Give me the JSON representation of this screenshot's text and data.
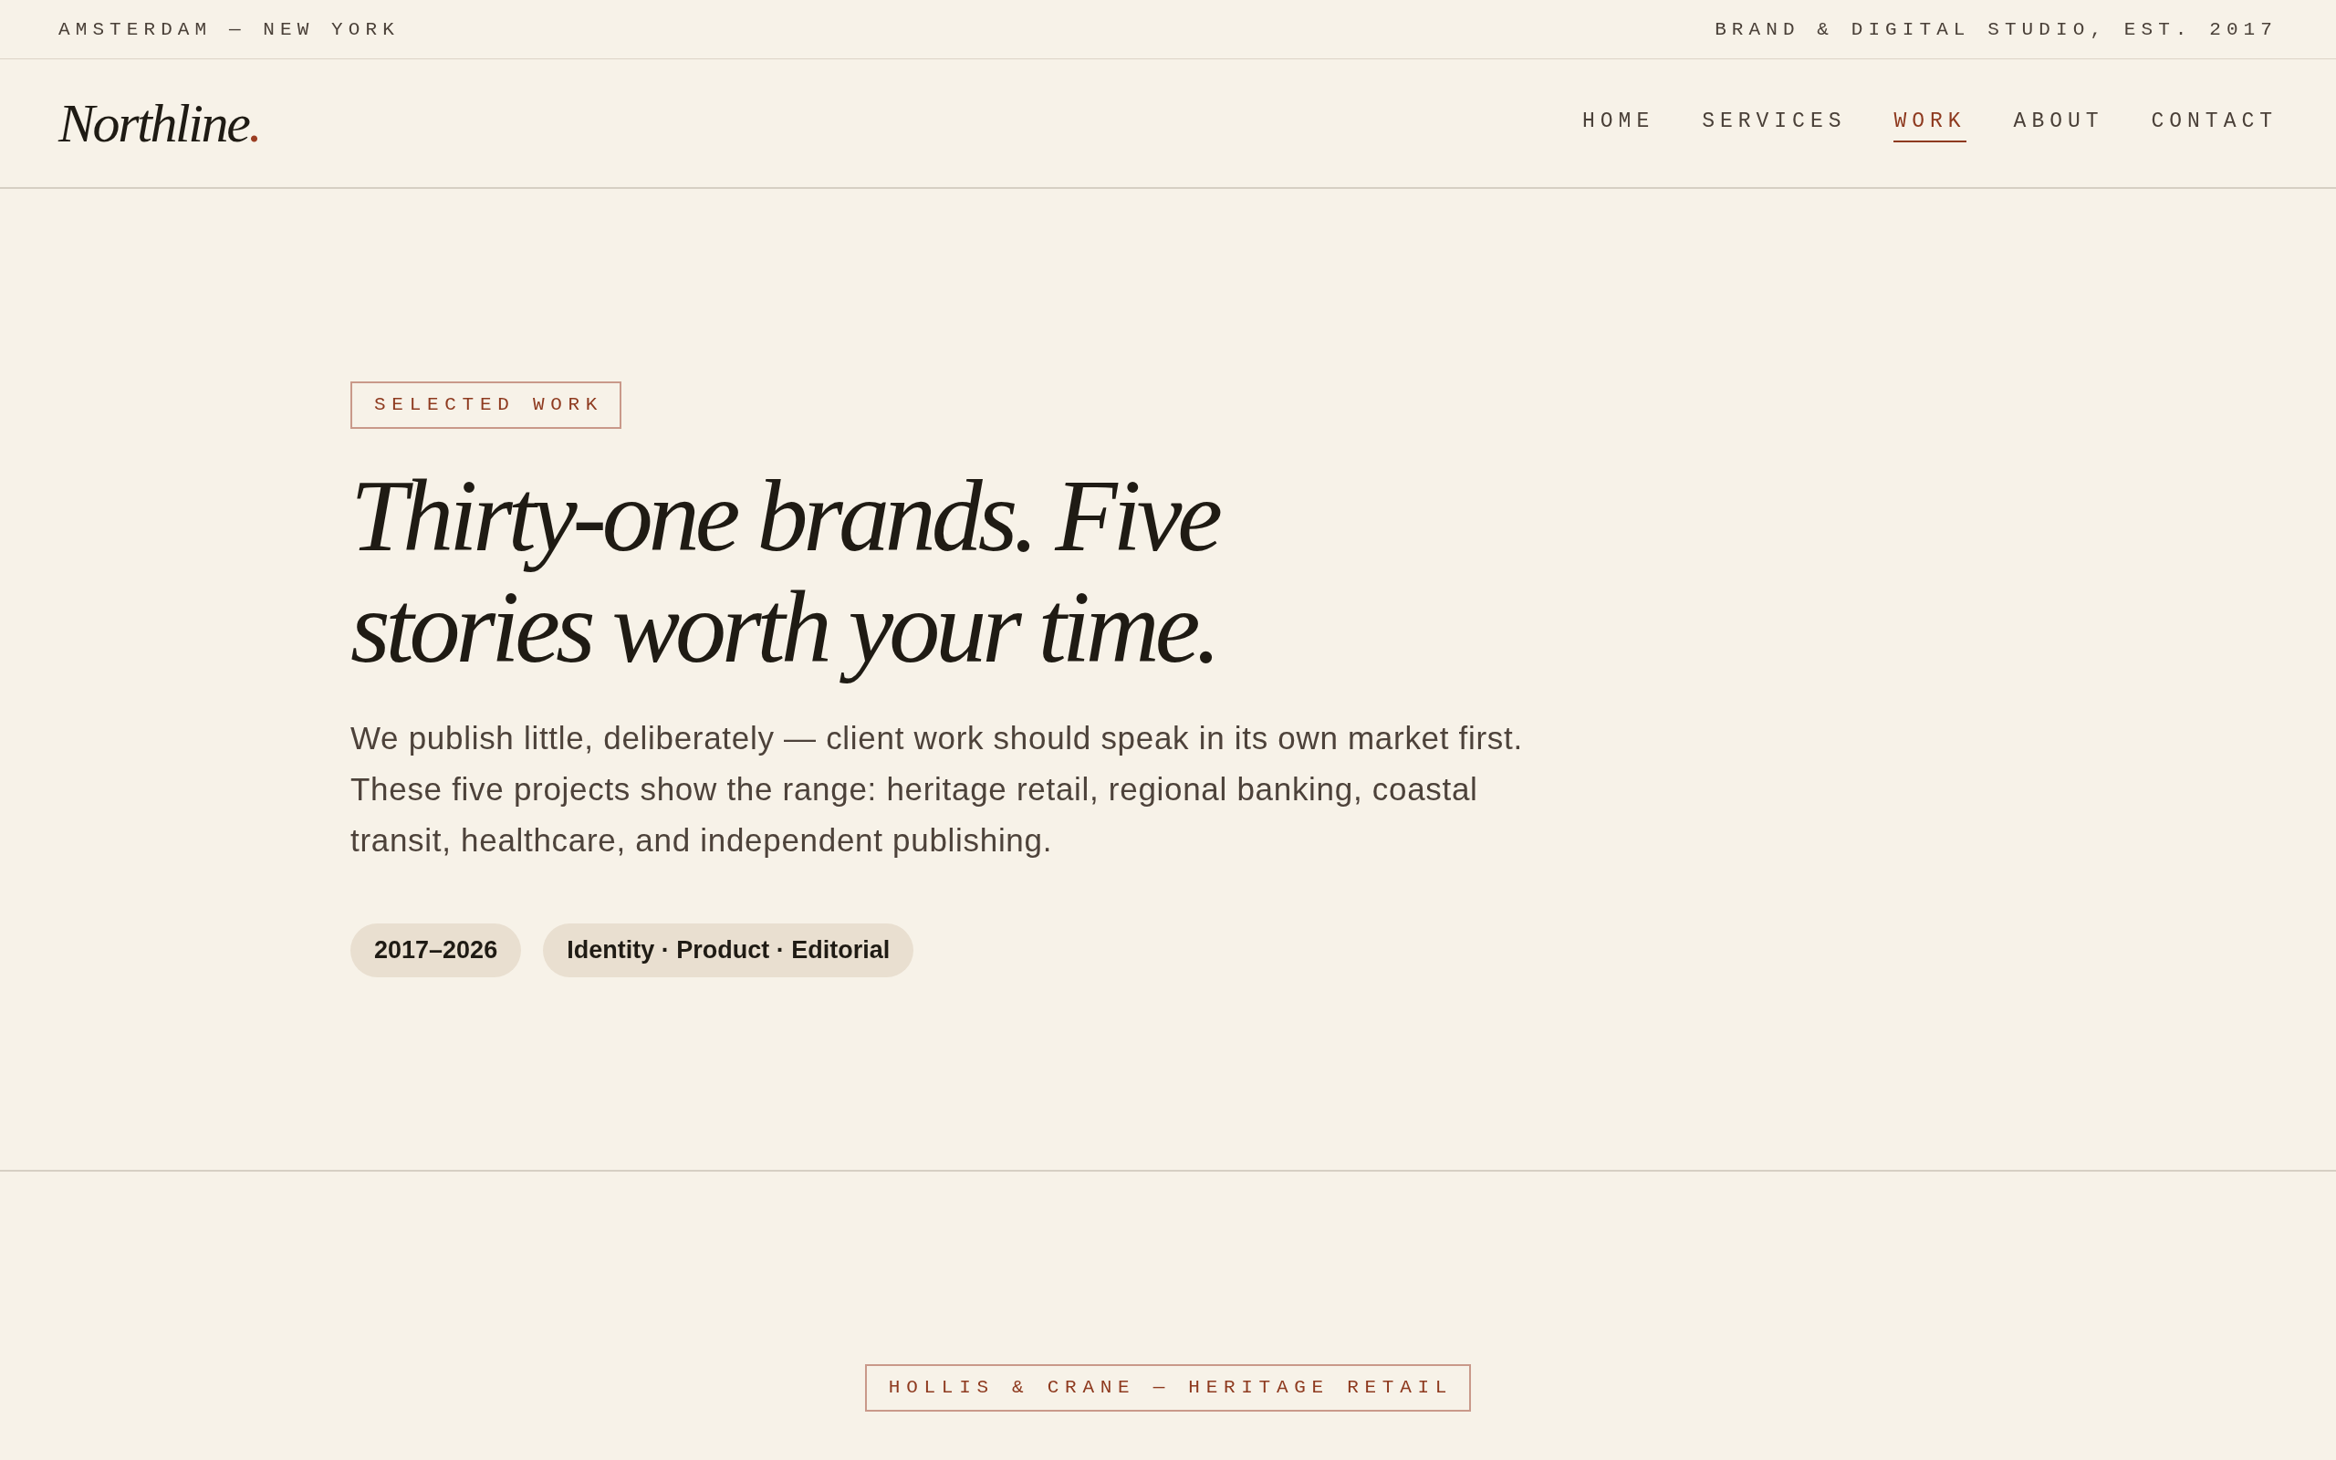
{
  "top_bar": {
    "location": "AMSTERDAM — NEW YORK",
    "tagline": "BRAND & DIGITAL STUDIO, EST. 2017"
  },
  "header": {
    "logo": {
      "name": "Northline",
      "dot": "."
    },
    "nav": [
      {
        "label": "HOME",
        "selected": false
      },
      {
        "label": "SERVICES",
        "selected": false
      },
      {
        "label": "WORK",
        "selected": true
      },
      {
        "label": "ABOUT",
        "selected": false
      },
      {
        "label": "CONTACT",
        "selected": false
      }
    ]
  },
  "hero": {
    "eyebrow": "SELECTED WORK",
    "heading": "Thirty-one brands. Five stories worth your time.",
    "intro": "We publish little, deliberately — client work should speak in its own market first. These five projects show the range: heritage retail, regional banking, coastal transit, healthcare, and independent publishing.",
    "tags": [
      "2017–2026",
      "Identity · Product · Editorial"
    ]
  },
  "case_study": {
    "label": "HOLLIS & CRANE — HERITAGE RETAIL"
  }
}
